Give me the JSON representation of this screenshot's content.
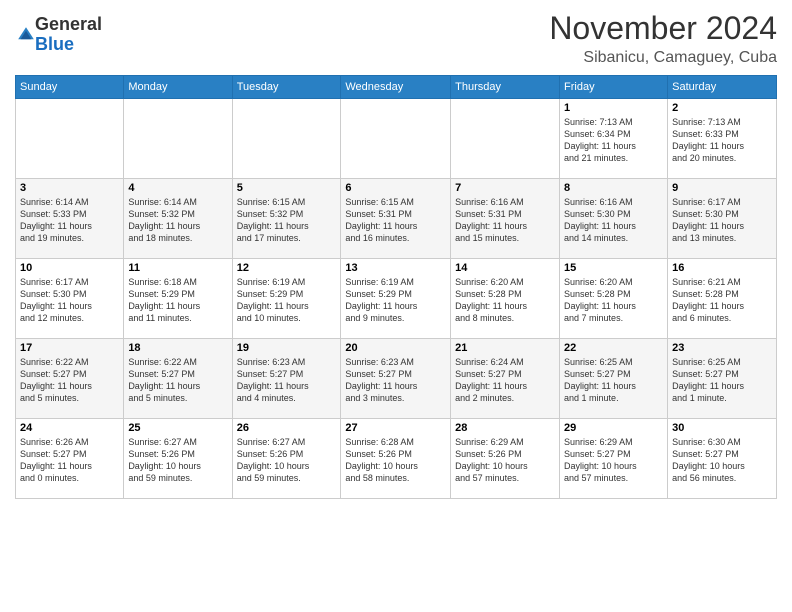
{
  "header": {
    "logo_line1": "General",
    "logo_line2": "Blue",
    "month_title": "November 2024",
    "subtitle": "Sibanicu, Camaguey, Cuba"
  },
  "weekdays": [
    "Sunday",
    "Monday",
    "Tuesday",
    "Wednesday",
    "Thursday",
    "Friday",
    "Saturday"
  ],
  "weeks": [
    [
      {
        "day": "",
        "info": ""
      },
      {
        "day": "",
        "info": ""
      },
      {
        "day": "",
        "info": ""
      },
      {
        "day": "",
        "info": ""
      },
      {
        "day": "",
        "info": ""
      },
      {
        "day": "1",
        "info": "Sunrise: 7:13 AM\nSunset: 6:34 PM\nDaylight: 11 hours\nand 21 minutes."
      },
      {
        "day": "2",
        "info": "Sunrise: 7:13 AM\nSunset: 6:33 PM\nDaylight: 11 hours\nand 20 minutes."
      }
    ],
    [
      {
        "day": "3",
        "info": "Sunrise: 6:14 AM\nSunset: 5:33 PM\nDaylight: 11 hours\nand 19 minutes."
      },
      {
        "day": "4",
        "info": "Sunrise: 6:14 AM\nSunset: 5:32 PM\nDaylight: 11 hours\nand 18 minutes."
      },
      {
        "day": "5",
        "info": "Sunrise: 6:15 AM\nSunset: 5:32 PM\nDaylight: 11 hours\nand 17 minutes."
      },
      {
        "day": "6",
        "info": "Sunrise: 6:15 AM\nSunset: 5:31 PM\nDaylight: 11 hours\nand 16 minutes."
      },
      {
        "day": "7",
        "info": "Sunrise: 6:16 AM\nSunset: 5:31 PM\nDaylight: 11 hours\nand 15 minutes."
      },
      {
        "day": "8",
        "info": "Sunrise: 6:16 AM\nSunset: 5:30 PM\nDaylight: 11 hours\nand 14 minutes."
      },
      {
        "day": "9",
        "info": "Sunrise: 6:17 AM\nSunset: 5:30 PM\nDaylight: 11 hours\nand 13 minutes."
      }
    ],
    [
      {
        "day": "10",
        "info": "Sunrise: 6:17 AM\nSunset: 5:30 PM\nDaylight: 11 hours\nand 12 minutes."
      },
      {
        "day": "11",
        "info": "Sunrise: 6:18 AM\nSunset: 5:29 PM\nDaylight: 11 hours\nand 11 minutes."
      },
      {
        "day": "12",
        "info": "Sunrise: 6:19 AM\nSunset: 5:29 PM\nDaylight: 11 hours\nand 10 minutes."
      },
      {
        "day": "13",
        "info": "Sunrise: 6:19 AM\nSunset: 5:29 PM\nDaylight: 11 hours\nand 9 minutes."
      },
      {
        "day": "14",
        "info": "Sunrise: 6:20 AM\nSunset: 5:28 PM\nDaylight: 11 hours\nand 8 minutes."
      },
      {
        "day": "15",
        "info": "Sunrise: 6:20 AM\nSunset: 5:28 PM\nDaylight: 11 hours\nand 7 minutes."
      },
      {
        "day": "16",
        "info": "Sunrise: 6:21 AM\nSunset: 5:28 PM\nDaylight: 11 hours\nand 6 minutes."
      }
    ],
    [
      {
        "day": "17",
        "info": "Sunrise: 6:22 AM\nSunset: 5:27 PM\nDaylight: 11 hours\nand 5 minutes."
      },
      {
        "day": "18",
        "info": "Sunrise: 6:22 AM\nSunset: 5:27 PM\nDaylight: 11 hours\nand 5 minutes."
      },
      {
        "day": "19",
        "info": "Sunrise: 6:23 AM\nSunset: 5:27 PM\nDaylight: 11 hours\nand 4 minutes."
      },
      {
        "day": "20",
        "info": "Sunrise: 6:23 AM\nSunset: 5:27 PM\nDaylight: 11 hours\nand 3 minutes."
      },
      {
        "day": "21",
        "info": "Sunrise: 6:24 AM\nSunset: 5:27 PM\nDaylight: 11 hours\nand 2 minutes."
      },
      {
        "day": "22",
        "info": "Sunrise: 6:25 AM\nSunset: 5:27 PM\nDaylight: 11 hours\nand 1 minute."
      },
      {
        "day": "23",
        "info": "Sunrise: 6:25 AM\nSunset: 5:27 PM\nDaylight: 11 hours\nand 1 minute."
      }
    ],
    [
      {
        "day": "24",
        "info": "Sunrise: 6:26 AM\nSunset: 5:27 PM\nDaylight: 11 hours\nand 0 minutes."
      },
      {
        "day": "25",
        "info": "Sunrise: 6:27 AM\nSunset: 5:26 PM\nDaylight: 10 hours\nand 59 minutes."
      },
      {
        "day": "26",
        "info": "Sunrise: 6:27 AM\nSunset: 5:26 PM\nDaylight: 10 hours\nand 59 minutes."
      },
      {
        "day": "27",
        "info": "Sunrise: 6:28 AM\nSunset: 5:26 PM\nDaylight: 10 hours\nand 58 minutes."
      },
      {
        "day": "28",
        "info": "Sunrise: 6:29 AM\nSunset: 5:26 PM\nDaylight: 10 hours\nand 57 minutes."
      },
      {
        "day": "29",
        "info": "Sunrise: 6:29 AM\nSunset: 5:27 PM\nDaylight: 10 hours\nand 57 minutes."
      },
      {
        "day": "30",
        "info": "Sunrise: 6:30 AM\nSunset: 5:27 PM\nDaylight: 10 hours\nand 56 minutes."
      }
    ]
  ]
}
